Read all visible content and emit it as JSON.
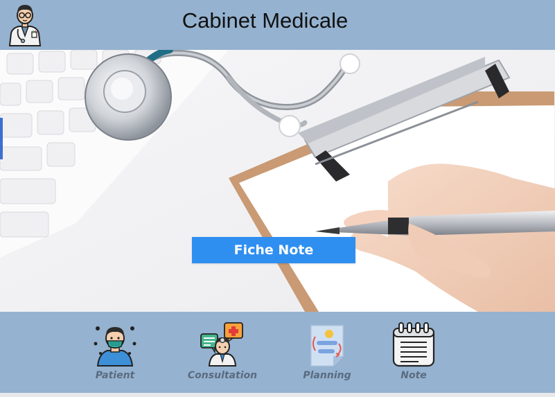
{
  "header": {
    "title": "Cabinet Medicale",
    "logo_icon": "doctor-avatar-icon"
  },
  "main": {
    "hero_image": "stethoscope-clipboard-writing-photo",
    "fiche_button_label": "Fiche Note",
    "accent_color": "#2f8ff0"
  },
  "nav": {
    "items": [
      {
        "label": "Patient",
        "icon": "patient-mask-icon"
      },
      {
        "label": "Consultation",
        "icon": "consultation-doctor-icon"
      },
      {
        "label": "Planning",
        "icon": "planning-icon"
      },
      {
        "label": "Note",
        "icon": "notepad-icon"
      }
    ]
  },
  "colors": {
    "header_bg": "#95b2d0",
    "footer_bg": "#95b2d0",
    "label_color": "#5a6b80"
  }
}
